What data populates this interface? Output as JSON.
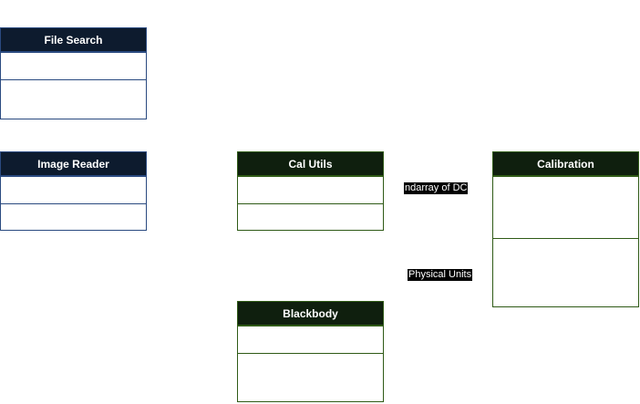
{
  "classes": {
    "file_search": {
      "title": "File Search"
    },
    "image_reader": {
      "title": "Image Reader"
    },
    "cal_utils": {
      "title": "Cal Utils"
    },
    "calibration": {
      "title": "Calibration"
    },
    "blackbody": {
      "title": "Blackbody"
    }
  },
  "edge_labels": {
    "dc_array": "ndarray of DC",
    "physical_units": "Physical Units"
  },
  "colors": {
    "blue_header": "#0d1b2e",
    "blue_border": "#2a4a80",
    "green_header": "#0f1f0e",
    "green_border": "#2f5a16"
  }
}
